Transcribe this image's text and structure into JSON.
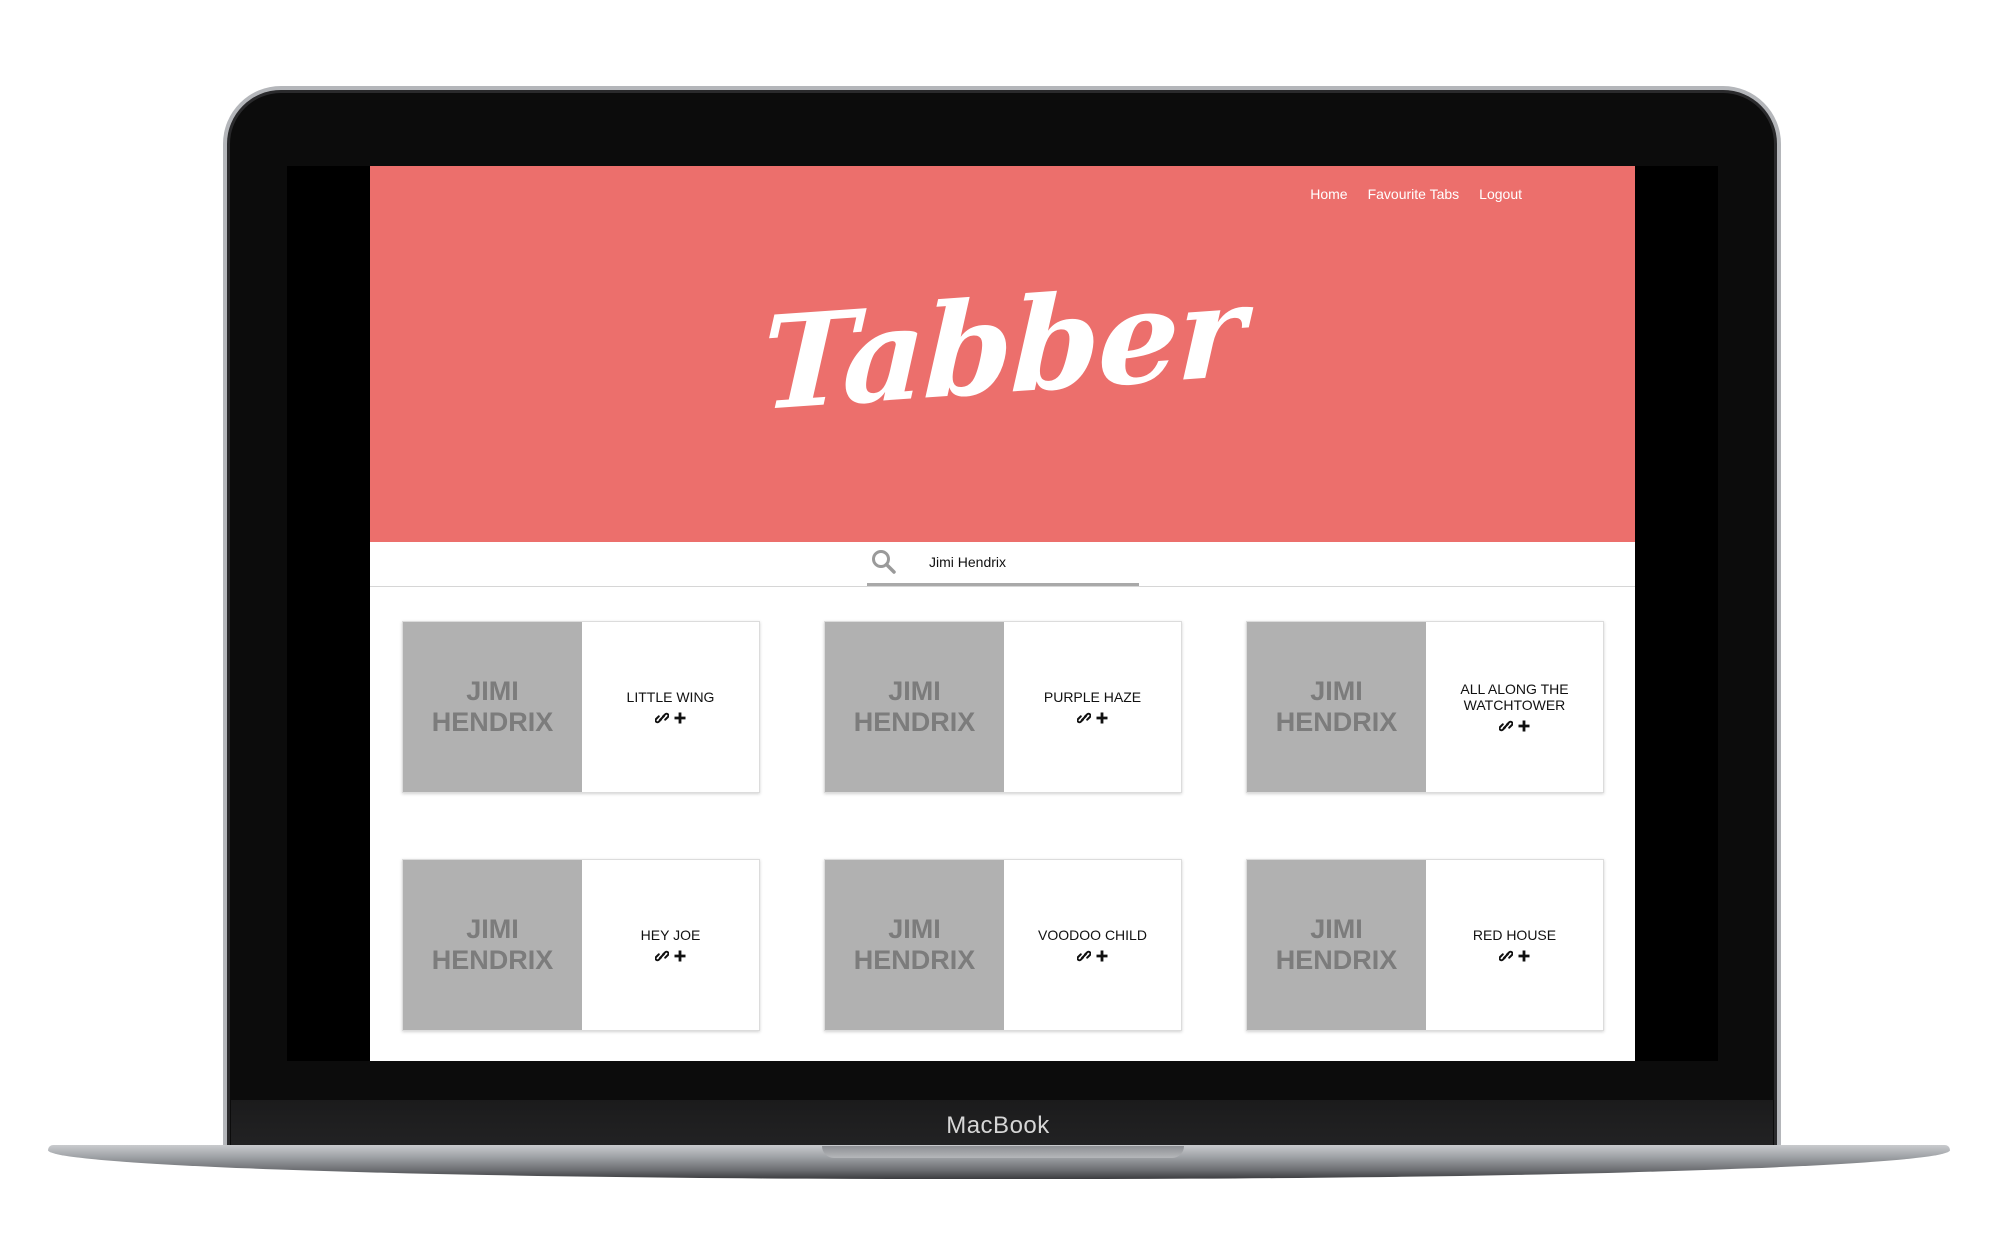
{
  "device": {
    "label": "MacBook"
  },
  "app": {
    "logo_text": "Tabber",
    "colors": {
      "hero": "#ec6f6c",
      "art": "#b1b1b1"
    }
  },
  "nav": {
    "items": [
      "Home",
      "Favourite Tabs",
      "Logout"
    ]
  },
  "search": {
    "value": "Jimi Hendrix",
    "icon": "search-icon"
  },
  "cards": [
    {
      "artist_line1": "JIMI",
      "artist_line2": "HENDRIX",
      "title_line1": "LITTLE WING",
      "title_line2": ""
    },
    {
      "artist_line1": "JIMI",
      "artist_line2": "HENDRIX",
      "title_line1": "PURPLE HAZE",
      "title_line2": ""
    },
    {
      "artist_line1": "JIMI",
      "artist_line2": "HENDRIX",
      "title_line1": "ALL ALONG THE",
      "title_line2": "WATCHTOWER"
    },
    {
      "artist_line1": "JIMI",
      "artist_line2": "HENDRIX",
      "title_line1": "HEY JOE",
      "title_line2": ""
    },
    {
      "artist_line1": "JIMI",
      "artist_line2": "HENDRIX",
      "title_line1": "VOODOO CHILD",
      "title_line2": ""
    },
    {
      "artist_line1": "JIMI",
      "artist_line2": "HENDRIX",
      "title_line1": "RED HOUSE",
      "title_line2": ""
    }
  ]
}
